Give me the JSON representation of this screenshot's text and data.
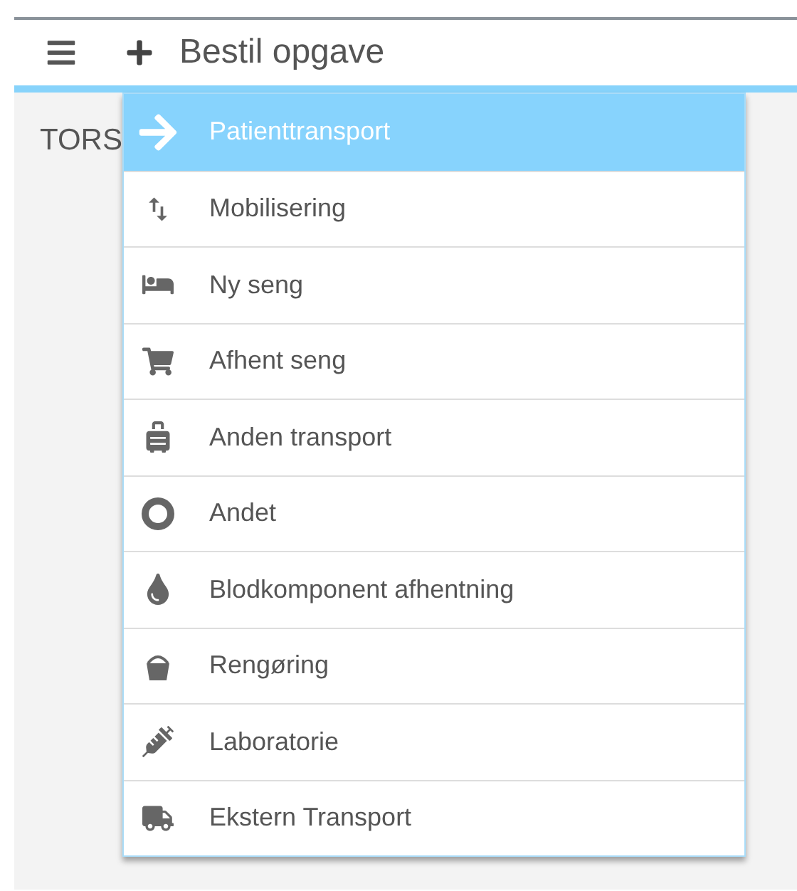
{
  "header": {
    "title": "Bestil opgave"
  },
  "body": {
    "heading": "TORS"
  },
  "menu": {
    "items": [
      {
        "label": "Patienttransport",
        "selected": true
      },
      {
        "label": "Mobilisering",
        "selected": false
      },
      {
        "label": "Ny seng",
        "selected": false
      },
      {
        "label": "Afhent seng",
        "selected": false
      },
      {
        "label": "Anden transport",
        "selected": false
      },
      {
        "label": "Andet",
        "selected": false
      },
      {
        "label": "Blodkomponent afhentning",
        "selected": false
      },
      {
        "label": "Rengøring",
        "selected": false
      },
      {
        "label": "Laboratorie",
        "selected": false
      },
      {
        "label": "Ekstern Transport",
        "selected": false
      }
    ]
  }
}
